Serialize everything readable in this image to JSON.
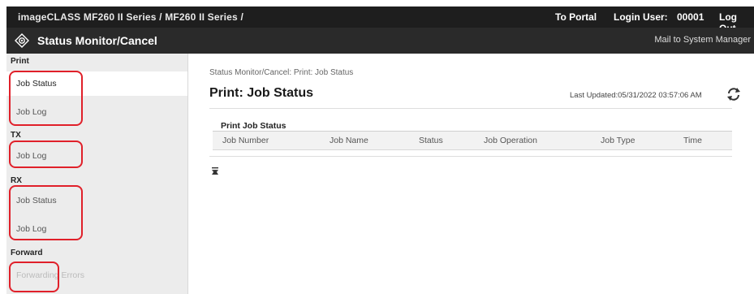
{
  "topbar": {
    "path": "imageCLASS   MF260 II Series / MF260 II Series /",
    "portal": "To Portal",
    "login_label": "Login User:",
    "user": "00001",
    "logout": "Log Out"
  },
  "header": {
    "title": "Status Monitor/Cancel",
    "mail": "Mail to System Manager",
    "logo_icon": "status-monitor-icon"
  },
  "sidebar": {
    "print_label": "Print",
    "print_job_status": "Job Status",
    "print_job_log": "Job Log",
    "tx_label": "TX",
    "tx_job_log": "Job Log",
    "rx_label": "RX",
    "rx_job_status": "Job Status",
    "rx_job_log": "Job Log",
    "forward_label": "Forward",
    "forwarding_errors": "Forwarding Errors"
  },
  "main": {
    "breadcrumb": "Status Monitor/Cancel: Print: Job Status",
    "title": "Print: Job Status",
    "last_updated": "Last Updated:05/31/2022 03:57:06 AM",
    "table_title": "Print Job Status",
    "columns": [
      "Job Number",
      "Job Name",
      "Status",
      "Job Operation",
      "Job Type",
      "Time"
    ]
  },
  "colors": {
    "highlight": "#e0202a",
    "topbar": "#1e1e1e",
    "header": "#2a2a2a",
    "sidebar": "#ececec"
  }
}
